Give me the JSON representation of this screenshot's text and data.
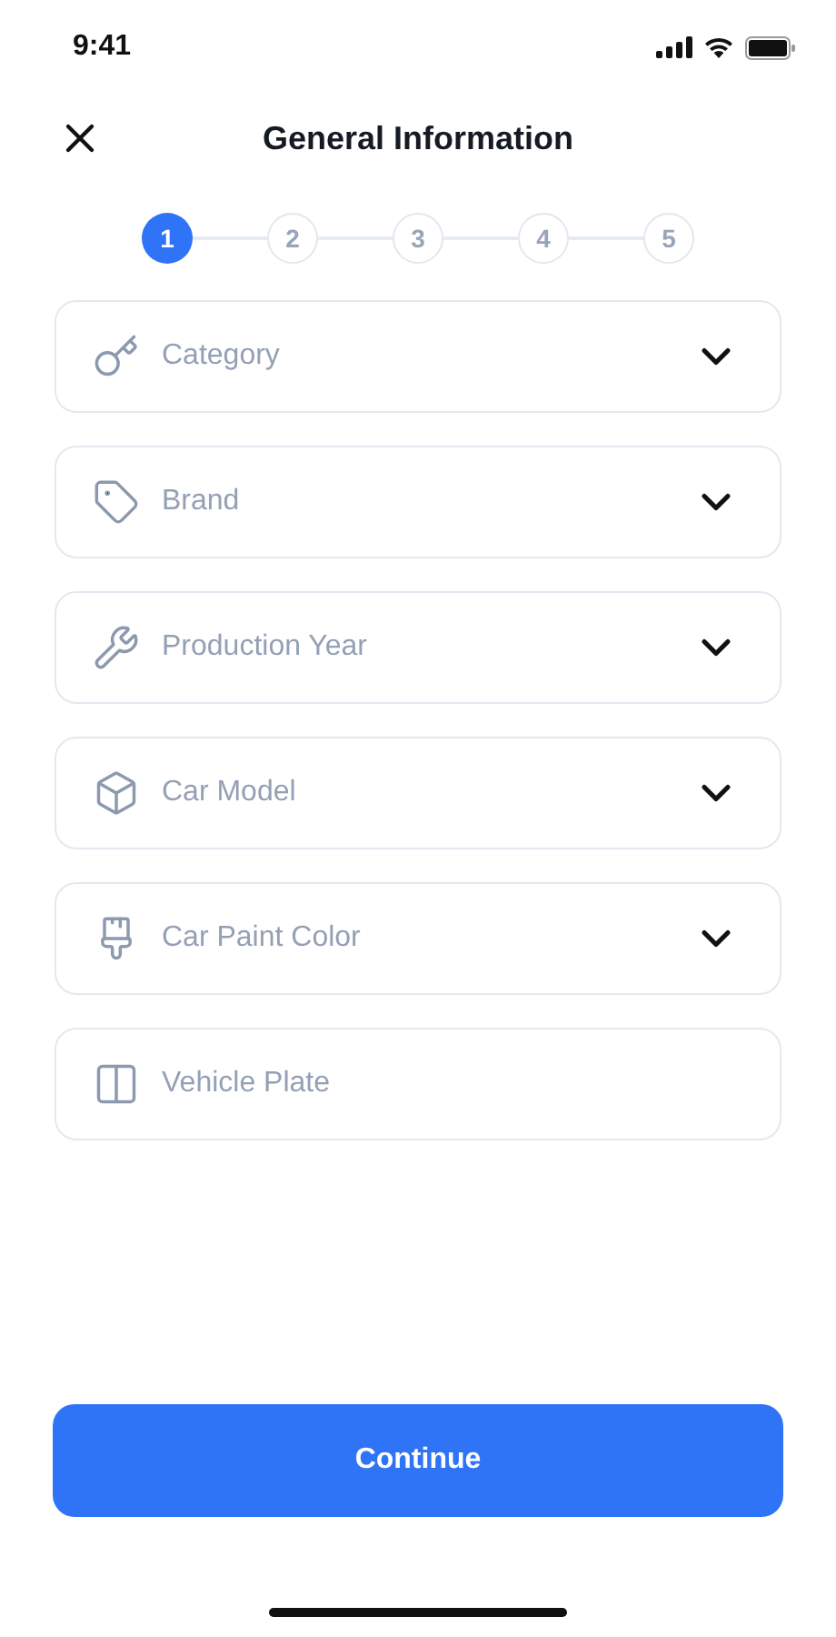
{
  "status_bar": {
    "time": "9:41"
  },
  "header": {
    "title": "General Information"
  },
  "steps": [
    {
      "label": "1",
      "selected": true
    },
    {
      "label": "2",
      "selected": false
    },
    {
      "label": "3",
      "selected": false
    },
    {
      "label": "4",
      "selected": false
    },
    {
      "label": "5",
      "selected": false
    }
  ],
  "fields": [
    {
      "kind": "dropdown",
      "placeholder": "Category"
    },
    {
      "kind": "dropdown",
      "placeholder": "Brand"
    },
    {
      "kind": "dropdown",
      "placeholder": "Production Year"
    },
    {
      "kind": "dropdown",
      "placeholder": "Car Model"
    },
    {
      "kind": "dropdown",
      "placeholder": "Car Paint Color"
    },
    {
      "kind": "input",
      "placeholder": "Vehicle Plate"
    }
  ],
  "button": {
    "label": "Continue"
  }
}
